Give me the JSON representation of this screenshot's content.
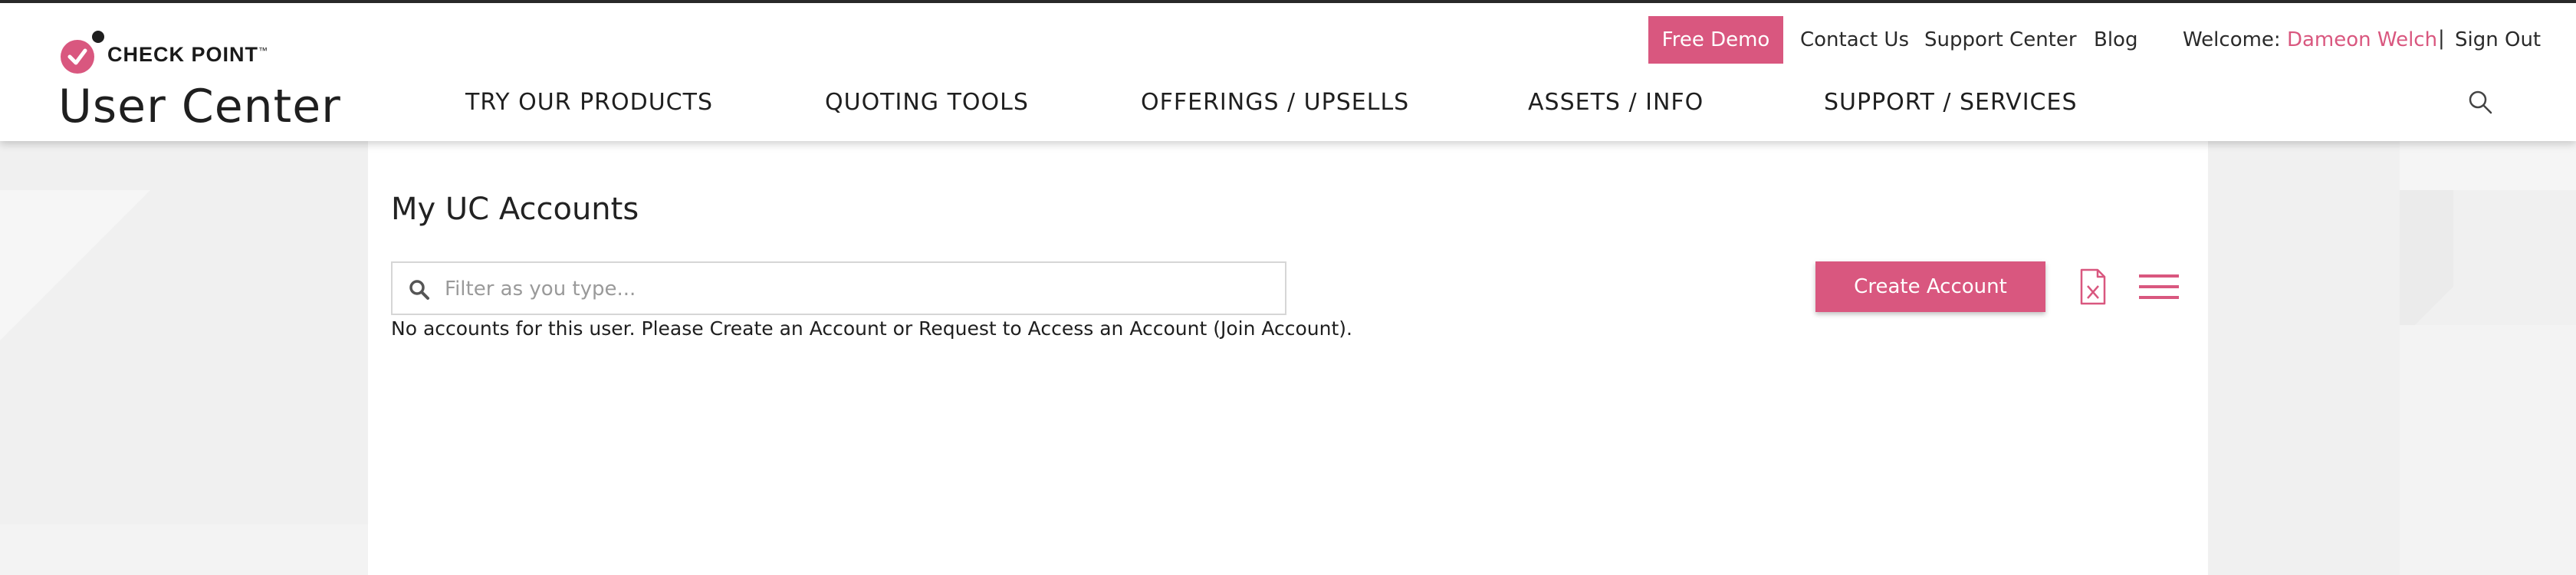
{
  "header": {
    "brand_name": "CHECK POINT",
    "brand_tm": "™",
    "site_title": "User Center",
    "util_nav": {
      "free_demo": "Free Demo",
      "contact_us": "Contact Us",
      "support_center": "Support Center",
      "blog": "Blog",
      "welcome_prefix": "Welcome:",
      "user_name": "Dameon Welch",
      "separator": "|",
      "sign_out": "Sign Out"
    },
    "main_nav": [
      {
        "label": "TRY OUR PRODUCTS"
      },
      {
        "label": "QUOTING TOOLS"
      },
      {
        "label": "OFFERINGS / UPSELLS"
      },
      {
        "label": "ASSETS / INFO"
      },
      {
        "label": "SUPPORT / SERVICES"
      }
    ],
    "search_icon": "magnifier-icon"
  },
  "content": {
    "page_title": "My UC Accounts",
    "filter": {
      "placeholder": "Filter as you type...",
      "value": "",
      "icon": "search-icon"
    },
    "empty_message": "No accounts for this user. Please Create an Account or Request to Access an Account (Join Account).",
    "create_button": "Create Account",
    "export_icon": "excel-export-icon",
    "menu_icon": "hamburger-menu-icon"
  },
  "colors": {
    "accent": "#d9577f",
    "text": "#1f1f1f",
    "background": "#f0f0f0",
    "panel": "#ffffff"
  }
}
